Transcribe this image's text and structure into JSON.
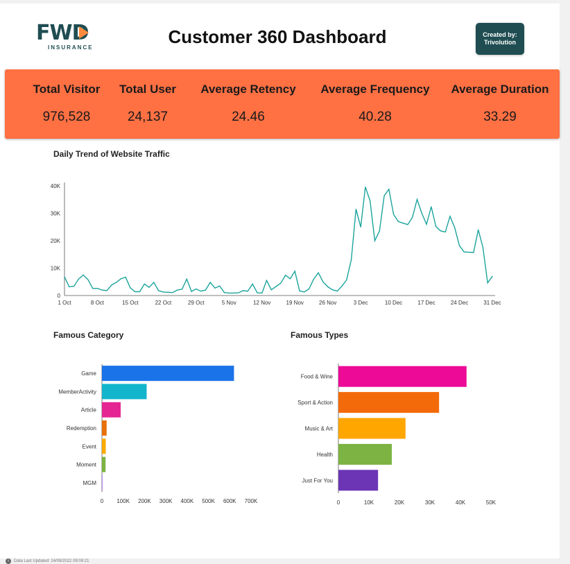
{
  "header": {
    "logo_text": "FWD",
    "logo_subtitle": "INSURANCE",
    "title": "Customer 360 Dashboard",
    "creator_line1": "Created by:",
    "creator_line2": "Trivolution"
  },
  "colors": {
    "kpi_band": "#ff7043",
    "brand": "#1f4d52",
    "logo_accent": "#ff8a3d",
    "line": "#1ba39c"
  },
  "kpis": [
    {
      "label": "Total Visitor",
      "value": "976,528"
    },
    {
      "label": "Total User",
      "value": "24,137"
    },
    {
      "label": "Average Retency",
      "value": "24.46"
    },
    {
      "label": "Average Frequency",
      "value": "40.28"
    },
    {
      "label": "Average Duration",
      "value": "33.29"
    }
  ],
  "charts": {
    "traffic_title": "Daily Trend of Website Traffic",
    "category_title": "Famous Category",
    "types_title": "Famous Types"
  },
  "footer": {
    "text": "Data Last Updated: 24/09/2022 09:09:21"
  },
  "chart_data": [
    {
      "type": "line",
      "title": "Daily Trend of Website Traffic",
      "xlabel": "",
      "ylabel": "",
      "ylim": [
        0,
        40000
      ],
      "yticks": [
        "0",
        "10K",
        "20K",
        "30K",
        "40K"
      ],
      "xticks": [
        "1 Oct",
        "8 Oct",
        "15 Oct",
        "22 Oct",
        "29 Oct",
        "5 Nov",
        "12 Nov",
        "19 Nov",
        "26 Nov",
        "3 Dec",
        "10 Dec",
        "17 Dec",
        "24 Dec",
        "31 Dec"
      ],
      "x_start": "1 Oct",
      "x_end": "31 Dec",
      "color": "#1ba39c",
      "grid": false,
      "values": [
        6800,
        3200,
        3400,
        6000,
        7500,
        5800,
        2600,
        2600,
        2000,
        1800,
        3800,
        4800,
        6100,
        6700,
        2800,
        1400,
        1400,
        4200,
        3000,
        4800,
        1800,
        1300,
        1200,
        1100,
        2000,
        2300,
        6000,
        1500,
        2400,
        1600,
        2000,
        4800,
        2700,
        3500,
        1100,
        900,
        900,
        1000,
        1800,
        1600,
        4200,
        1000,
        900,
        5500,
        2100,
        3300,
        4500,
        7400,
        6100,
        8900,
        1700,
        1300,
        2400,
        6000,
        8300,
        5000,
        3200,
        2100,
        1600,
        3400,
        5700,
        13100,
        31500,
        25000,
        39600,
        34500,
        20000,
        23600,
        36400,
        38800,
        29600,
        27000,
        26400,
        25900,
        28500,
        35100,
        30000,
        26000,
        32400,
        25200,
        23600,
        23200,
        28900,
        24700,
        18200,
        15900,
        15800,
        15700,
        24000,
        17600,
        4600,
        7000
      ]
    },
    {
      "type": "bar",
      "orientation": "horizontal",
      "title": "Famous Category",
      "categories": [
        "Game",
        "MemberActivity",
        "Article",
        "Redemption",
        "Event",
        "Moment",
        "MGM"
      ],
      "values": [
        620000,
        210000,
        88000,
        22000,
        18000,
        17000,
        1000
      ],
      "colors": [
        "#1a73e8",
        "#12b5cb",
        "#e52592",
        "#e8710a",
        "#f9ab00",
        "#7cb342",
        "#9334e6"
      ],
      "xlim": [
        0,
        700000
      ],
      "xticks": [
        "0",
        "100K",
        "200K",
        "300K",
        "400K",
        "500K",
        "600K",
        "700K"
      ]
    },
    {
      "type": "bar",
      "orientation": "horizontal",
      "title": "Famous Types",
      "categories": [
        "Food & Wine",
        "Sport & Action",
        "Music & Art",
        "Health",
        "Just For You"
      ],
      "values": [
        42000,
        33000,
        22000,
        17500,
        13000
      ],
      "colors": [
        "#ec0a96",
        "#f36a0a",
        "#ffa600",
        "#7cb342",
        "#6c35b5"
      ],
      "xlim": [
        0,
        50000
      ],
      "xticks": [
        "0",
        "10K",
        "20K",
        "30K",
        "40K",
        "50K"
      ]
    }
  ]
}
